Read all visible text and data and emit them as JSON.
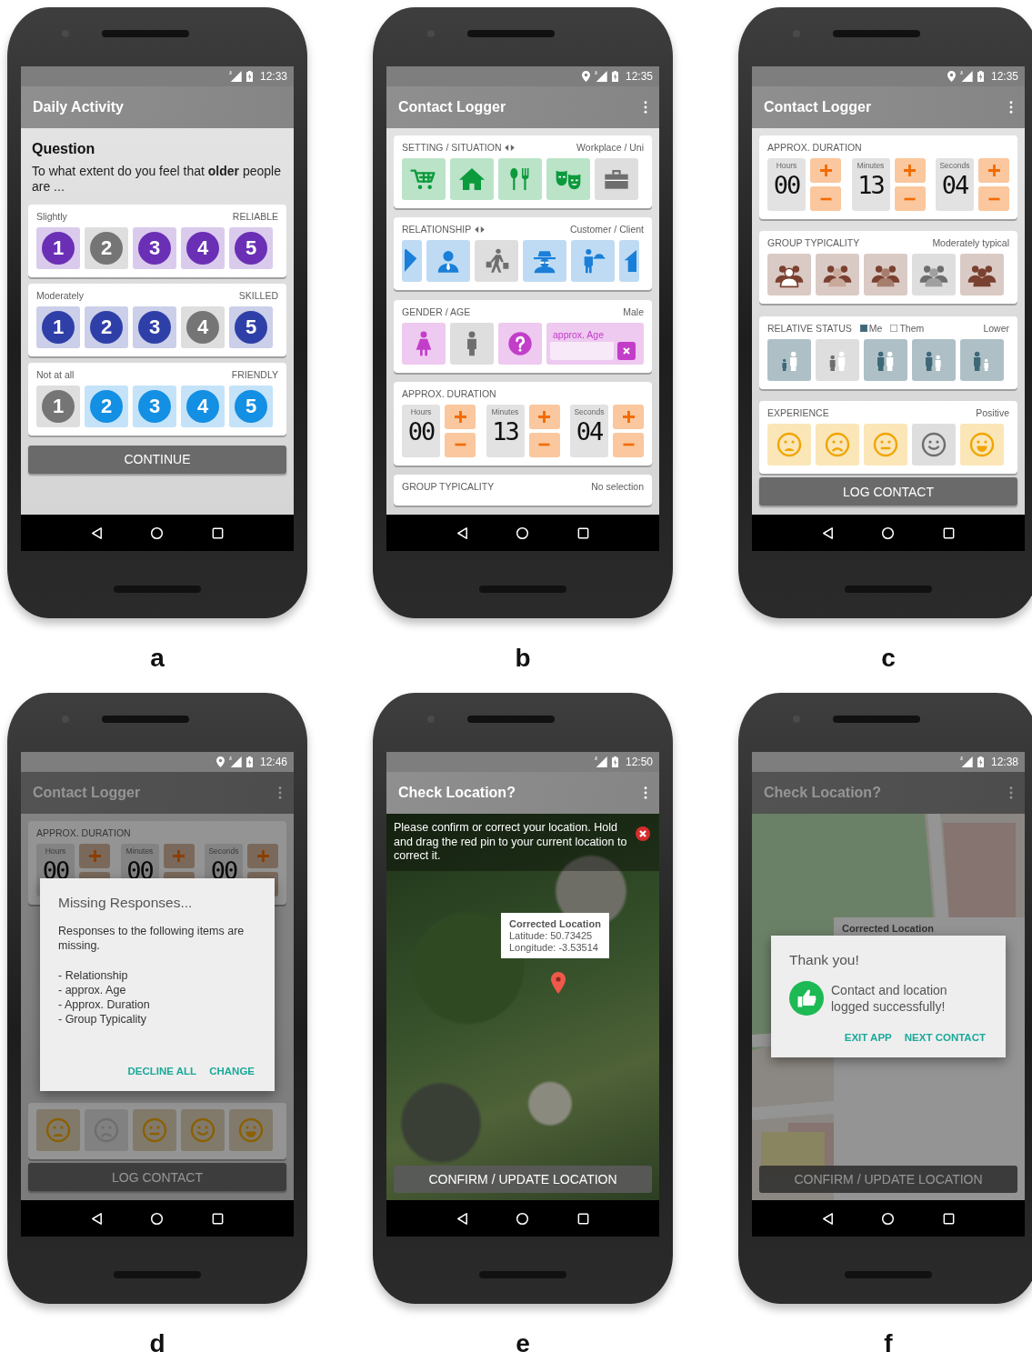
{
  "panels": [
    {
      "label": "a",
      "kind": "survey",
      "status": {
        "location": false,
        "time": "12:33"
      },
      "title": "Daily Activity",
      "menu": false,
      "question": {
        "heading": "Question",
        "text": "To what extent do you feel that **older** people are ..."
      },
      "scales": [
        {
          "answer": "Slightly",
          "trait": "RELIABLE",
          "color": "#6a2fb5",
          "options": [
            {
              "label": "1",
              "selected": false
            },
            {
              "label": "2",
              "selected": true
            },
            {
              "label": "3",
              "selected": false
            },
            {
              "label": "4",
              "selected": false
            },
            {
              "label": "5",
              "selected": false
            }
          ]
        },
        {
          "answer": "Moderately",
          "trait": "SKILLED",
          "color": "#2f3fa8",
          "options": [
            {
              "label": "1",
              "selected": false
            },
            {
              "label": "2",
              "selected": false
            },
            {
              "label": "3",
              "selected": false
            },
            {
              "label": "4",
              "selected": true
            },
            {
              "label": "5",
              "selected": false
            }
          ]
        },
        {
          "answer": "Not at all",
          "trait": "FRIENDLY",
          "color": "#138fe3",
          "options": [
            {
              "label": "1",
              "selected": true
            },
            {
              "label": "2",
              "selected": false
            },
            {
              "label": "3",
              "selected": false
            },
            {
              "label": "4",
              "selected": false
            },
            {
              "label": "5",
              "selected": false
            }
          ]
        }
      ],
      "button": "CONTINUE"
    },
    {
      "label": "b",
      "kind": "form",
      "status": {
        "location": true,
        "time": "12:35"
      },
      "title": "Contact Logger",
      "menu": true,
      "sections": [
        {
          "kind": "setting",
          "heading": "SETTING / SITUATION",
          "arrows": true,
          "value": "Workplace / Uni",
          "color": "#0b9a3c",
          "tiles": [
            {
              "selected": false
            },
            {
              "selected": false
            },
            {
              "selected": false
            },
            {
              "selected": false
            },
            {
              "selected": true
            }
          ]
        },
        {
          "kind": "relationship",
          "heading": "RELATIONSHIP",
          "arrows": true,
          "value": "Customer / Client",
          "color": "#1a7fd8",
          "tiles": [
            {
              "selected": false
            },
            {
              "selected": false
            },
            {
              "selected": true
            },
            {
              "selected": false
            },
            {
              "selected": false
            },
            {
              "selected": false
            }
          ]
        },
        {
          "kind": "gender",
          "heading": "GENDER / AGE",
          "value": "Male",
          "color": "#c23ec9",
          "tiles": [
            {
              "selected": false
            },
            {
              "selected": true
            },
            {
              "selected": false
            }
          ],
          "age_field": {
            "placeholder": "approx. Age"
          }
        },
        {
          "kind": "duration",
          "heading": "APPROX. DURATION",
          "color": "#f26b00",
          "fields": [
            {
              "label": "Hours",
              "value": "00"
            },
            {
              "label": "Minutes",
              "value": "13"
            },
            {
              "label": "Seconds",
              "value": "04"
            }
          ]
        },
        {
          "kind": "typicality",
          "heading": "GROUP TYPICALITY",
          "value": "No selection"
        }
      ]
    },
    {
      "label": "c",
      "kind": "form",
      "status": {
        "location": true,
        "time": "12:35"
      },
      "title": "Contact Logger",
      "menu": true,
      "sections": [
        {
          "kind": "duration",
          "heading": "APPROX. DURATION",
          "color": "#f26b00",
          "fields": [
            {
              "label": "Hours",
              "value": "00"
            },
            {
              "label": "Minutes",
              "value": "13"
            },
            {
              "label": "Seconds",
              "value": "04"
            }
          ]
        },
        {
          "kind": "typicality",
          "heading": "GROUP TYPICALITY",
          "value": "Moderately typical",
          "color": "#7a4030",
          "tiles": [
            {
              "selected": false
            },
            {
              "selected": false
            },
            {
              "selected": false
            },
            {
              "selected": true
            },
            {
              "selected": false
            }
          ]
        },
        {
          "kind": "status",
          "heading": "RELATIVE STATUS",
          "legend": [
            {
              "label": "Me",
              "filled": true
            },
            {
              "label": "Them",
              "filled": false
            }
          ],
          "value": "Lower",
          "color": "#3e6878",
          "tiles": [
            {
              "selected": false
            },
            {
              "selected": true
            },
            {
              "selected": false
            },
            {
              "selected": false
            },
            {
              "selected": false
            }
          ]
        },
        {
          "kind": "experience",
          "heading": "EXPERIENCE",
          "value": "Positive",
          "color": "#f0a500",
          "tiles": [
            {
              "selected": false
            },
            {
              "selected": false
            },
            {
              "selected": false
            },
            {
              "selected": true
            },
            {
              "selected": false
            }
          ]
        }
      ],
      "button": "LOG CONTACT"
    },
    {
      "label": "d",
      "kind": "form",
      "status": {
        "location": true,
        "time": "12:46"
      },
      "title": "Contact Logger",
      "menu": true,
      "sections": [
        {
          "kind": "duration",
          "heading": "APPROX. DURATION",
          "color": "#8c3e00",
          "fields": [
            {
              "label": "Hours",
              "value": "00"
            },
            {
              "label": "Minutes",
              "value": "00"
            },
            {
              "label": "Seconds",
              "value": "00"
            }
          ]
        },
        {
          "kind": "experience",
          "color": "#8b6000",
          "tiles": [
            {
              "selected": false
            },
            {
              "selected": true
            },
            {
              "selected": false
            },
            {
              "selected": false
            },
            {
              "selected": false
            }
          ]
        }
      ],
      "button": "LOG CONTACT",
      "dialog": {
        "kind": "missing",
        "title": "Missing Responses...",
        "text": "Responses to the following items are missing.",
        "items": [
          "- Relationship",
          "- approx. Age",
          "- Approx. Duration",
          "- Group Typicality"
        ],
        "actions": [
          "DECLINE ALL",
          "CHANGE"
        ]
      }
    },
    {
      "label": "e",
      "kind": "satellite",
      "status": {
        "location": false,
        "time": "12:50"
      },
      "title": "Check Location?",
      "menu": true,
      "notice": "Please confirm or correct your location. Hold and drag the red pin to your current location to correct it.",
      "info": {
        "title": "Corrected Location",
        "lines": [
          "Latitude: 50.73425",
          "Longitude: -3.53514"
        ]
      },
      "button": "CONFIRM / UPDATE LOCATION"
    },
    {
      "label": "f",
      "kind": "street",
      "status": {
        "location": false,
        "time": "12:38"
      },
      "title": "Check Location?",
      "menu": true,
      "info": {
        "title": "Corrected Location"
      },
      "button": "CONFIRM / UPDATE LOCATION",
      "dialog": {
        "kind": "success",
        "title": "Thank you!",
        "text": "Contact and location logged successfully!",
        "actions": [
          "EXIT APP",
          "NEXT CONTACT"
        ]
      }
    }
  ]
}
